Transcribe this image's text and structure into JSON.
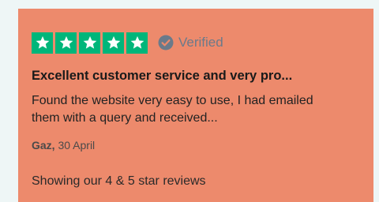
{
  "review": {
    "rating": 5,
    "max_rating": 5,
    "verified_label": "Verified",
    "title": "Excellent customer service and very pro...",
    "body": "Found the website very easy to use, I had emailed them with a query and received...",
    "author": "Gaz,",
    "date": "30 April"
  },
  "footer": {
    "text": "Showing our 4 & 5 star reviews"
  },
  "colors": {
    "card_background": "#ed8a6c",
    "star_green": "#00b67a",
    "verified_gray": "#6b7a8a"
  },
  "icons": {
    "star": "star-icon",
    "verified": "verified-check-icon"
  }
}
